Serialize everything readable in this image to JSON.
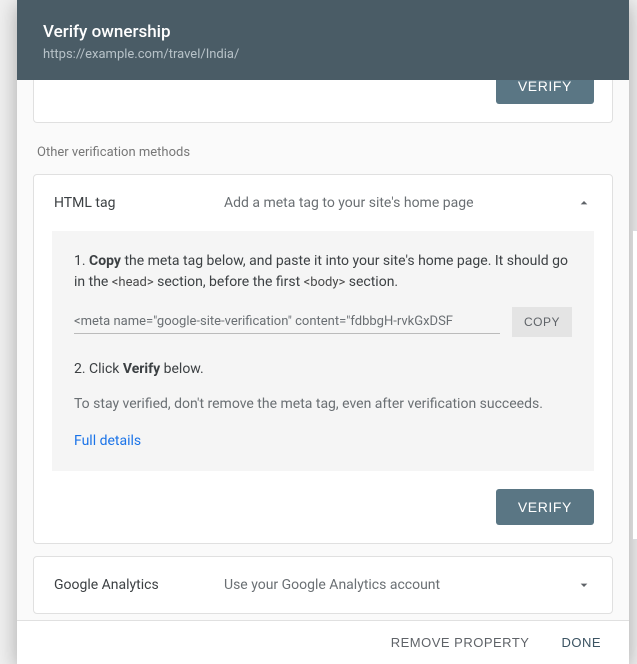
{
  "header": {
    "title": "Verify ownership",
    "url": "https://example.com/travel/India/"
  },
  "topCard": {
    "verify_label": "VERIFY"
  },
  "section_other_methods": "Other verification methods",
  "htmlTag": {
    "name": "HTML tag",
    "desc": "Add a meta tag to your site's home page",
    "step1_prefix": "1. ",
    "step1_bold": "Copy",
    "step1_mid": " the meta tag below, and paste it into your site's home page. It should go in the ",
    "step1_code1": "<head>",
    "step1_mid2": " section, before the first ",
    "step1_code2": "<body>",
    "step1_end": " section.",
    "meta_value": "<meta name=\"google-site-verification\" content=\"fdbbgH-rvkGxDSF",
    "copy_label": "COPY",
    "step2_prefix": "2. Click ",
    "step2_bold": "Verify",
    "step2_end": " below.",
    "note": "To stay verified, don't remove the meta tag, even after verification succeeds.",
    "details_link": "Full details",
    "verify_label": "VERIFY"
  },
  "analytics": {
    "name": "Google Analytics",
    "desc": "Use your Google Analytics account"
  },
  "footer": {
    "remove": "REMOVE PROPERTY",
    "done": "DONE"
  }
}
